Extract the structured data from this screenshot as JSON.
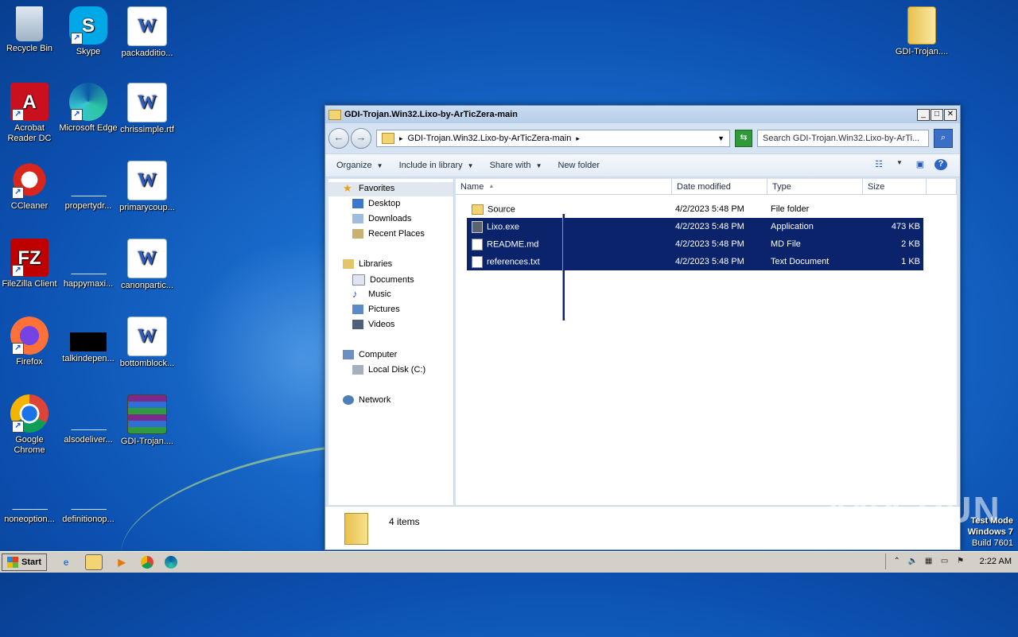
{
  "desktop": {
    "icons": [
      {
        "label": "Recycle Bin"
      },
      {
        "label": "Skype"
      },
      {
        "label": "packadditio..."
      },
      {
        "label": "Acrobat Reader DC"
      },
      {
        "label": "Microsoft Edge"
      },
      {
        "label": "chrissimple.rtf"
      },
      {
        "label": "CCleaner"
      },
      {
        "label": "propertydr..."
      },
      {
        "label": "primarycoup..."
      },
      {
        "label": "FileZilla Client"
      },
      {
        "label": "happymaxi..."
      },
      {
        "label": "canonpartic..."
      },
      {
        "label": "Firefox"
      },
      {
        "label": "talkindepen..."
      },
      {
        "label": "bottomblock..."
      },
      {
        "label": "Google Chrome"
      },
      {
        "label": "alsodeliver..."
      },
      {
        "label": "GDI-Trojan...."
      },
      {
        "label": "noneoption..."
      },
      {
        "label": "definitionop..."
      },
      {
        "label": "GDI-Trojan...."
      }
    ]
  },
  "window": {
    "title": "GDI-Trojan.Win32.Lixo-by-ArTicZera-main",
    "address": "GDI-Trojan.Win32.Lixo-by-ArTicZera-main",
    "search_placeholder": "Search GDI-Trojan.Win32.Lixo-by-ArTi...",
    "toolbar": {
      "organize": "Organize",
      "include": "Include in library",
      "share": "Share with",
      "new_folder": "New folder"
    },
    "nav": {
      "favorites": "Favorites",
      "desktop": "Desktop",
      "downloads": "Downloads",
      "recent": "Recent Places",
      "libraries": "Libraries",
      "documents": "Documents",
      "music": "Music",
      "pictures": "Pictures",
      "videos": "Videos",
      "computer": "Computer",
      "localdisk": "Local Disk (C:)",
      "network": "Network"
    },
    "columns": {
      "name": "Name",
      "date": "Date modified",
      "type": "Type",
      "size": "Size"
    },
    "files": [
      {
        "name": "Source",
        "date": "4/2/2023 5:48 PM",
        "type": "File folder",
        "size": ""
      },
      {
        "name": "Lixo.exe",
        "date": "4/2/2023 5:48 PM",
        "type": "Application",
        "size": "473 KB"
      },
      {
        "name": "README.md",
        "date": "4/2/2023 5:48 PM",
        "type": "MD File",
        "size": "2 KB"
      },
      {
        "name": "references.txt",
        "date": "4/2/2023 5:48 PM",
        "type": "Text Document",
        "size": "1 KB"
      }
    ],
    "status": "4 items"
  },
  "taskbar": {
    "start": "Start",
    "clock": "2:22 AM"
  },
  "watermark": {
    "line1": "Test Mode",
    "line2": "Windows 7",
    "line3": "Build 7601",
    "anyrun": "ANY RUN"
  }
}
